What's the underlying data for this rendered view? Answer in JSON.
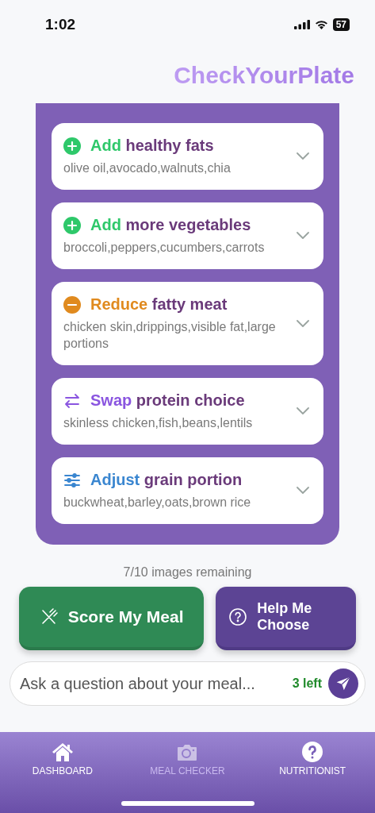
{
  "status_bar": {
    "time": "1:02",
    "battery": "57"
  },
  "app_title": "CheckYourPlate",
  "suggestions": [
    {
      "kind": "add",
      "verb": "Add",
      "topic": "healthy fats",
      "examples": "olive oil,avocado,walnuts,chia",
      "expanded": false
    },
    {
      "kind": "add",
      "verb": "Add",
      "topic": "more vegetables",
      "examples": "broccoli,peppers,cucumbers,carrots",
      "expanded": false
    },
    {
      "kind": "reduce",
      "verb": "Reduce",
      "topic": "fatty meat",
      "examples": "chicken skin,drippings,visible fat,large portions",
      "expanded": false
    },
    {
      "kind": "swap",
      "verb": "Swap",
      "topic": "protein choice",
      "examples": "skinless chicken,fish,beans,lentils",
      "expanded": false
    },
    {
      "kind": "adjust",
      "verb": "Adjust",
      "topic": "grain portion",
      "examples": "buckwheat,barley,oats,brown rice",
      "expanded": false
    }
  ],
  "images_remaining": "7/10 images remaining",
  "buttons": [
    {
      "kind": "score",
      "label": "Score My Meal"
    },
    {
      "kind": "help",
      "label": "Help Me Choose"
    }
  ],
  "question": {
    "placeholder": "Ask a question about your meal...",
    "remaining": "3 left"
  },
  "tabs": [
    {
      "kind": "home",
      "label": "DASHBOARD",
      "selected": false
    },
    {
      "kind": "camera",
      "label": "MEAL CHECKER",
      "selected": true
    },
    {
      "kind": "help",
      "label": "NUTRITIONIST",
      "selected": false
    }
  ]
}
